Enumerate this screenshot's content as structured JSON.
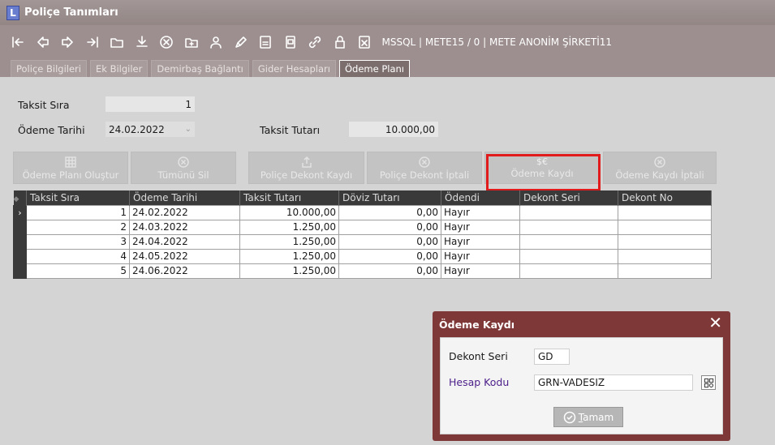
{
  "window": {
    "title": "Poliçe Tanımları",
    "logo": "L"
  },
  "toolbar": {
    "icons": [
      "first-record-icon",
      "prev-record-icon",
      "next-record-icon",
      "last-record-icon",
      "folder-icon",
      "download-icon",
      "cancel-icon",
      "add-icon",
      "user-icon",
      "edit-icon",
      "report-icon",
      "print-icon",
      "link-icon",
      "lock-icon",
      "excel-icon"
    ],
    "info": "MSSQL | METE15 / 0 | METE ANONİM ŞİRKETİ11"
  },
  "tabs": [
    "Poliçe Bilgileri",
    "Ek Bilgiler",
    "Demirbaş Bağlantı",
    "Gider Hesapları",
    "Ödeme Planı"
  ],
  "form": {
    "taksit_sira_label": "Taksit Sıra",
    "taksit_sira_value": "1",
    "odeme_tarihi_label": "Ödeme Tarihi",
    "odeme_tarihi_value": "24.02.2022",
    "taksit_tutari_label": "Taksit Tutarı",
    "taksit_tutari_value": "10.000,00"
  },
  "actions": {
    "odeme_plani_olustur": "Ödeme Planı Oluştur",
    "tumunu_sil": "Tümünü Sil",
    "police_dekont_kaydi": "Poliçe Dekont Kaydı",
    "police_dekont_iptali": "Poliçe Dekont İptali",
    "odeme_kaydi": "Ödeme Kaydı",
    "odeme_kaydi_iptali": "Ödeme Kaydı İptali"
  },
  "grid": {
    "columns": [
      "Taksit Sıra",
      "Ödeme Tarihi",
      "Taksit Tutarı",
      "Döviz Tutarı",
      "Ödendi",
      "Dekont Seri",
      "Dekont No"
    ],
    "rows": [
      [
        "1",
        "24.02.2022",
        "10.000,00",
        "0,00",
        "Hayır",
        "",
        ""
      ],
      [
        "2",
        "24.03.2022",
        "1.250,00",
        "0,00",
        "Hayır",
        "",
        ""
      ],
      [
        "3",
        "24.04.2022",
        "1.250,00",
        "0,00",
        "Hayır",
        "",
        ""
      ],
      [
        "4",
        "24.05.2022",
        "1.250,00",
        "0,00",
        "Hayır",
        "",
        ""
      ],
      [
        "5",
        "24.06.2022",
        "1.250,00",
        "0,00",
        "Hayır",
        "",
        ""
      ]
    ]
  },
  "dialog": {
    "title": "Ödeme Kaydı",
    "dekont_seri_label": "Dekont Seri",
    "dekont_seri_value": "GD",
    "hesap_kodu_label": "Hesap Kodu",
    "hesap_kodu_value": "GRN-VADESIZ",
    "ok_label": "Tamam",
    "ok_mnemonic": "T",
    "ok_rest": "amam"
  },
  "colors": {
    "titlebar": "#988a8a",
    "dialog": "#7e3838",
    "highlight": "#e11b1b",
    "hesap_label": "#4b1e8a"
  }
}
